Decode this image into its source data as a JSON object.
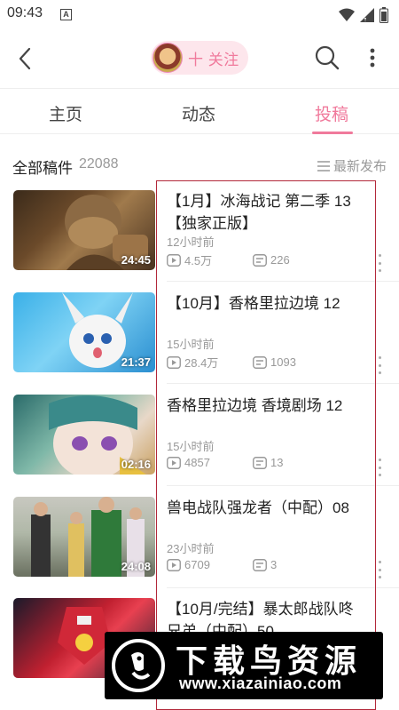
{
  "status_bar": {
    "time": "09:43",
    "notification_letter": "A"
  },
  "top_nav": {
    "follow_label": "十 关注"
  },
  "tabs": [
    {
      "label": "主页",
      "active": false
    },
    {
      "label": "动态",
      "active": false
    },
    {
      "label": "投稿",
      "active": true
    }
  ],
  "list_header": {
    "all_label": "全部稿件",
    "count": "22088",
    "sort_label": "最新发布"
  },
  "videos": [
    {
      "title": "【1月】冰海战记 第二季 13【独家正版】",
      "duration": "24:45",
      "time_ago": "12小时前",
      "views": "4.5万",
      "comments": "226"
    },
    {
      "title": "【10月】香格里拉边境 12",
      "duration": "21:37",
      "time_ago": "15小时前",
      "views": "28.4万",
      "comments": "1093"
    },
    {
      "title": "香格里拉边境 香境剧场 12",
      "duration": "02:16",
      "time_ago": "15小时前",
      "views": "4857",
      "comments": "13"
    },
    {
      "title": "兽电战队强龙者（中配）08",
      "duration": "24:08",
      "time_ago": "23小时前",
      "views": "6709",
      "comments": "3"
    },
    {
      "title": "【10月/完结】暴太郎战队咚兄弟（中配）50",
      "duration": "",
      "time_ago": "",
      "views": "",
      "comments": ""
    }
  ],
  "watermark": {
    "title": "下载鸟资源",
    "url": "www.xiazainiao.com"
  },
  "colors": {
    "accent": "#f07a9c",
    "highlight_border": "#b2283a",
    "muted": "#999999"
  }
}
